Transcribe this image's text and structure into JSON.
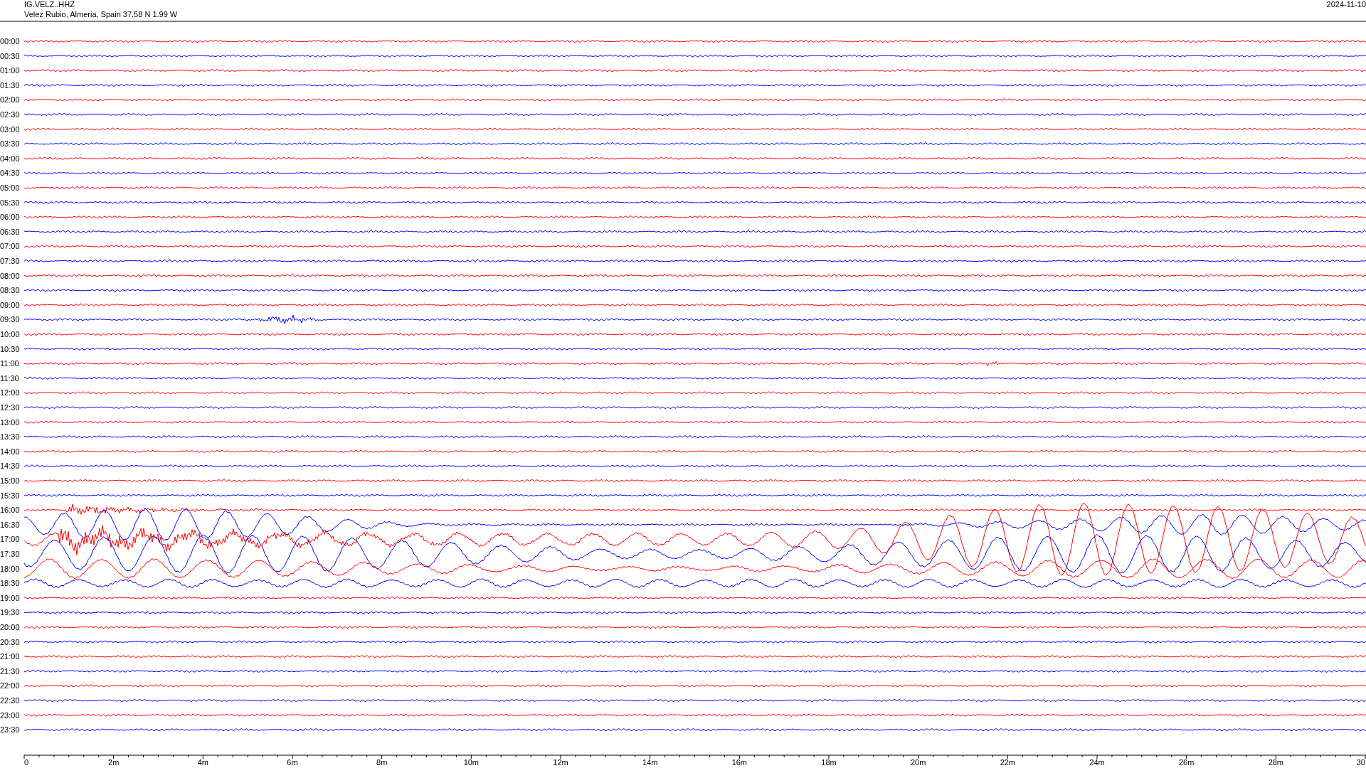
{
  "header": {
    "station": "IG.VELZ..HHZ",
    "location": "Velez Rubio, Almeria, Spain  37.58 N 1.99 W",
    "date": "2024-11-10"
  },
  "rows": [
    {
      "label": "00:00",
      "color": "#ff0000"
    },
    {
      "label": "00:30",
      "color": "#0000ff"
    },
    {
      "label": "01:00",
      "color": "#ff0000"
    },
    {
      "label": "01:30",
      "color": "#0000ff"
    },
    {
      "label": "02:00",
      "color": "#ff0000"
    },
    {
      "label": "02:30",
      "color": "#0000ff"
    },
    {
      "label": "03:00",
      "color": "#ff0000"
    },
    {
      "label": "03:30",
      "color": "#0000ff"
    },
    {
      "label": "04:00",
      "color": "#ff0000"
    },
    {
      "label": "04:30",
      "color": "#0000ff"
    },
    {
      "label": "05:00",
      "color": "#ff0000"
    },
    {
      "label": "05:30",
      "color": "#0000ff"
    },
    {
      "label": "06:00",
      "color": "#ff0000"
    },
    {
      "label": "06:30",
      "color": "#0000ff"
    },
    {
      "label": "07:00",
      "color": "#ff0000"
    },
    {
      "label": "07:30",
      "color": "#0000ff"
    },
    {
      "label": "08:00",
      "color": "#ff0000"
    },
    {
      "label": "08:30",
      "color": "#0000ff"
    },
    {
      "label": "09:00",
      "color": "#ff0000"
    },
    {
      "label": "09:30",
      "color": "#0000ff"
    },
    {
      "label": "10:00",
      "color": "#ff0000"
    },
    {
      "label": "10:30",
      "color": "#0000ff"
    },
    {
      "label": "11:00",
      "color": "#ff0000"
    },
    {
      "label": "11:30",
      "color": "#0000ff"
    },
    {
      "label": "12:00",
      "color": "#ff0000"
    },
    {
      "label": "12:30",
      "color": "#0000ff"
    },
    {
      "label": "13:00",
      "color": "#ff0000"
    },
    {
      "label": "13:30",
      "color": "#0000ff"
    },
    {
      "label": "14:00",
      "color": "#ff0000"
    },
    {
      "label": "14:30",
      "color": "#0000ff"
    },
    {
      "label": "15:00",
      "color": "#ff0000"
    },
    {
      "label": "15:30",
      "color": "#0000ff"
    },
    {
      "label": "16:00",
      "color": "#ff0000"
    },
    {
      "label": "16:30",
      "color": "#0000ff"
    },
    {
      "label": "17:00",
      "color": "#ff0000"
    },
    {
      "label": "17:30",
      "color": "#0000ff"
    },
    {
      "label": "18:00",
      "color": "#ff0000"
    },
    {
      "label": "18:30",
      "color": "#0000ff"
    },
    {
      "label": "19:00",
      "color": "#ff0000"
    },
    {
      "label": "19:30",
      "color": "#0000ff"
    },
    {
      "label": "20:00",
      "color": "#ff0000"
    },
    {
      "label": "20:30",
      "color": "#0000ff"
    },
    {
      "label": "21:00",
      "color": "#ff0000"
    },
    {
      "label": "21:30",
      "color": "#0000ff"
    },
    {
      "label": "22:00",
      "color": "#ff0000"
    },
    {
      "label": "22:30",
      "color": "#0000ff"
    },
    {
      "label": "23:00",
      "color": "#ff0000"
    },
    {
      "label": "23:30",
      "color": "#0000ff"
    }
  ],
  "x_axis": {
    "labels": [
      "0",
      "2m",
      "4m",
      "6m",
      "8m",
      "10m",
      "12m",
      "14m",
      "16m",
      "18m",
      "20m",
      "22m",
      "24m",
      "26m",
      "28m",
      "30"
    ]
  }
}
